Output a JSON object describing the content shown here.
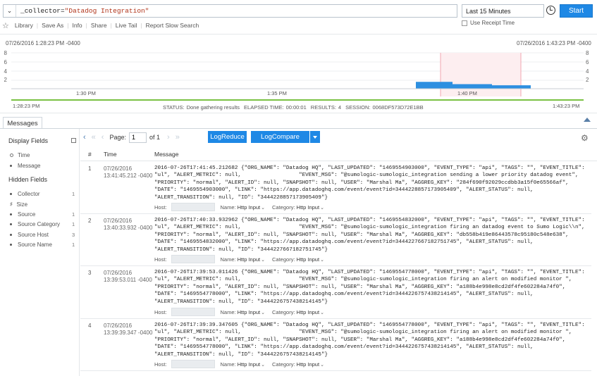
{
  "query": {
    "prefix": "_collector=",
    "value": "\"Datadog Integration\"",
    "time_range": "Last 15 Minutes",
    "start_label": "Start",
    "receipt_time_label": "Use Receipt Time"
  },
  "toolbar": {
    "items": [
      "Library",
      "Save As",
      "Info",
      "Share",
      "Live Tail",
      "Report Slow Search"
    ]
  },
  "histogram": {
    "start_date": "07/26/2016 1:28:23 PM -0400",
    "end_date": "07/26/2016 1:43:23 PM -0400",
    "start_time": "1:28:23 PM",
    "end_time": "1:43:23 PM",
    "y_ticks": [
      "8",
      "6",
      "4",
      "2"
    ],
    "x_ticks": [
      "1:30 PM",
      "1:35 PM",
      "1:40 PM"
    ],
    "bars": [
      {
        "label": "1:39:00",
        "value": 1.5
      },
      {
        "label": "1:40:00",
        "value": 1.0
      },
      {
        "label": "1:41:00",
        "value": 0.75
      }
    ],
    "colors": {
      "bar": "#2d8fe0",
      "highlight": "#f7c9cf",
      "baseline": "#7ac143"
    }
  },
  "status": {
    "status_label": "STATUS:",
    "status_value": "Done gathering results",
    "elapsed_label": "ELAPSED TIME:",
    "elapsed_value": "00:00:01",
    "results_label": "RESULTS:",
    "results_value": "4",
    "session_label": "SESSION:",
    "session_value": "0068DF573D72E1BB"
  },
  "tabs": {
    "messages": "Messages"
  },
  "left_panel": {
    "display_fields_title": "Display Fields",
    "display_fields": [
      "Time",
      "Message"
    ],
    "hidden_fields_title": "Hidden Fields",
    "hidden_fields": [
      {
        "name": "Collector",
        "count": "1"
      },
      {
        "name": "Size",
        "count": ""
      },
      {
        "name": "Source",
        "count": "1"
      },
      {
        "name": "Source Category",
        "count": "1"
      },
      {
        "name": "Source Host",
        "count": "3"
      },
      {
        "name": "Source Name",
        "count": "1"
      }
    ]
  },
  "pager": {
    "page_label": "Page:",
    "page_value": "1",
    "of_label": "of 1",
    "logreduce": "LogReduce",
    "logcompare": "LogCompare"
  },
  "table": {
    "headers": [
      "#",
      "Time",
      "Message"
    ],
    "meta_labels": {
      "host": "Host:",
      "name": "Name:",
      "category": "Category:"
    },
    "rows": [
      {
        "num": "1",
        "date": "07/26/2016",
        "time": "13:41:45.212 -0400",
        "message": "2016-07-26T17:41:45.212682 {\"ORG_NAME\": \"Datadog HQ\", \"LAST_UPDATED\": \"1469554903000\", \"EVENT_TYPE\": \"api\", \"TAGS\": \"\", \"EVENT_TITLE\":\n\"ul\", \"ALERT_METRIC\": null,                  \"EVENT_MSG\": \"@sumologic-sumologic_integration sending a lower priority datadog event\",\n\"PRIORITY\": \"normal\", \"ALERT_ID\": null, \"SNAPSHOT\": null, \"USER\": \"Marshal Ma\", \"AGGREG_KEY\": \"284f690f92029ccdbb3a15f0e65566af\",\n\"DATE\": \"1469554903000\", \"LINK\": \"https://app.datadoghq.com/event/event?id=3444228857173905409\", \"ALERT_STATUS\": null,\n\"ALERT_TRANSITION\": null, \"ID\": \"3444228857173905409\"}",
        "name": "Http Input",
        "category": "Http Input"
      },
      {
        "num": "2",
        "date": "07/26/2016",
        "time": "13:40:33.932 -0400",
        "message": "2016-07-26T17:40:33.932962 {\"ORG_NAME\": \"Datadog HQ\", \"LAST_UPDATED\": \"1469554832000\", \"EVENT_TYPE\": \"api\", \"TAGS\": \"\", \"EVENT_TITLE\":\n\"ul\", \"ALERT_METRIC\": null,                  \"EVENT_MSG\": \"@sumologic-sumologic_integration firing an datadog event to Sumo Logic\\\\n\",\n\"PRIORITY\": \"normal\", \"ALERT_ID\": null, \"SNAPSHOT\": null, \"USER\": \"Marshal Ma\", \"AGGREG_KEY\": \"db558b419e86443578c95180c548e638\",\n\"DATE\": \"1469554832000\", \"LINK\": \"https://app.datadoghq.com/event/event?id=3444227667182751745\", \"ALERT_STATUS\": null,\n\"ALERT_TRANSITION\": null, \"ID\": \"3444227667182751745\"}",
        "name": "Http Input",
        "category": "Http Input"
      },
      {
        "num": "3",
        "date": "07/26/2016",
        "time": "13:39:53.011 -0400",
        "message": "2016-07-26T17:39:53.011426 {\"ORG_NAME\": \"Datadog HQ\", \"LAST_UPDATED\": \"1469554778000\", \"EVENT_TYPE\": \"api\", \"TAGS\": \"\", \"EVENT_TITLE\":\n\"ul\", \"ALERT_METRIC\": null,                  \"EVENT_MSG\": \"@sumologic-sumologic_integration firing an alert on modified monitor \",\n\"PRIORITY\": \"normal\", \"ALERT_ID\": null, \"SNAPSHOT\": null, \"USER\": \"Marshal Ma\", \"AGGREG_KEY\": \"a188b4e998e8cd2df4fe602284a74f0\",\n\"DATE\": \"1469554778000\", \"LINK\": \"https://app.datadoghq.com/event/event?id=3444226757438214145\", \"ALERT_STATUS\": null,\n\"ALERT_TRANSITION\": null, \"ID\": \"3444226757438214145\"}",
        "name": "Http Input",
        "category": "Http Input"
      },
      {
        "num": "4",
        "date": "07/26/2016",
        "time": "13:39:39.347 -0400",
        "message": "2016-07-26T17:39:39.347605 {\"ORG_NAME\": \"Datadog HQ\", \"LAST_UPDATED\": \"1469554778000\", \"EVENT_TYPE\": \"api\", \"TAGS\": \"\", \"EVENT_TITLE\":\n\"ul\", \"ALERT_METRIC\": null,                  \"EVENT_MSG\": \"@sumologic-sumologic_integration firing an alert on modified monitor \",\n\"PRIORITY\": \"normal\", \"ALERT_ID\": null, \"SNAPSHOT\": null, \"USER\": \"Marshal Ma\", \"AGGREG_KEY\": \"a188b4e998e8cd2df4fe602284a74f0\",\n\"DATE\": \"1469554778000\", \"LINK\": \"https://app.datadoghq.com/event/event?id=3444226757438214145\", \"ALERT_STATUS\": null,\n\"ALERT_TRANSITION\": null, \"ID\": \"3444226757438214145\"}",
        "name": "Http Input",
        "category": "Http Input"
      }
    ]
  }
}
